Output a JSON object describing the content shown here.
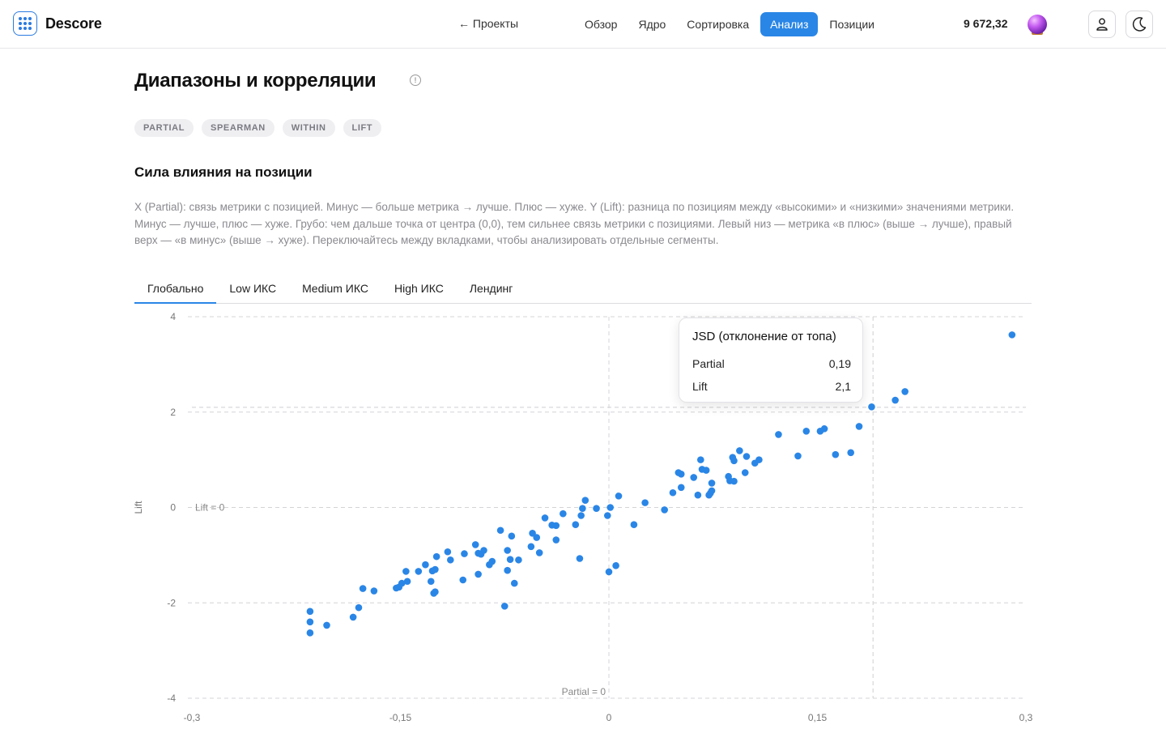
{
  "app": {
    "brand": "Descore",
    "back_label": "← Проекты",
    "nav": [
      "Обзор",
      "Ядро",
      "Сортировка",
      "Анализ",
      "Позиции"
    ],
    "nav_active": "Анализ",
    "balance": "9 672,32"
  },
  "page": {
    "title": "Диапазоны и корреляции",
    "chips": [
      "PARTIAL",
      "SPEARMAN",
      "WITHIN",
      "LIFT"
    ],
    "section_title": "Сила влияния на позиции",
    "description": "X (Partial): связь метрики с позицией. Минус — больше метрика → лучше. Плюс — хуже. Y (Lift): разница по позициям между «высокими» и «низкими» значениями метрики. Минус — лучше, плюс — хуже. Грубо: чем дальше точка от центра (0,0), тем сильнее связь метрики с позициями. Левый низ — метрика «в плюс» (выше → лучше), правый верх — «в минус» (выше → хуже). Переключайтесь между вкладками, чтобы анализировать отдельные сегменты.",
    "tabs": [
      "Глобально",
      "Low ИКС",
      "Medium ИКС",
      "High ИКС",
      "Лендинг"
    ],
    "tab_active": "Глобально"
  },
  "tooltip": {
    "title": "JSD (отклонение от топа)",
    "rows": [
      {
        "label": "Partial",
        "value": "0,19"
      },
      {
        "label": "Lift",
        "value": "2,1"
      }
    ]
  },
  "colors": {
    "accent": "#2a86e6",
    "point": "#2a86e6"
  },
  "chart_data": {
    "type": "scatter",
    "xlabel": "",
    "ylabel": "Lift",
    "xlim": [
      -0.3,
      0.3
    ],
    "ylim": [
      -4,
      4
    ],
    "x_ticks": [
      "-0,3",
      "-0,15",
      "0",
      "0,15",
      "0,3"
    ],
    "y_ticks": [
      "4",
      "2",
      "0",
      "-2",
      "-4"
    ],
    "annotations": [
      "Lift = 0",
      "Partial = 0"
    ],
    "grid": true,
    "crosshair": {
      "x": 0.19,
      "y": 2.1
    },
    "points": [
      [
        -0.215,
        -2.18
      ],
      [
        -0.215,
        -2.4
      ],
      [
        -0.215,
        -2.63
      ],
      [
        -0.203,
        -2.47
      ],
      [
        -0.184,
        -2.3
      ],
      [
        -0.18,
        -2.1
      ],
      [
        -0.177,
        -1.7
      ],
      [
        -0.169,
        -1.75
      ],
      [
        -0.153,
        -1.69
      ],
      [
        -0.151,
        -1.67
      ],
      [
        -0.149,
        -1.59
      ],
      [
        -0.146,
        -1.34
      ],
      [
        -0.145,
        -1.55
      ],
      [
        -0.137,
        -1.34
      ],
      [
        -0.132,
        -1.2
      ],
      [
        -0.128,
        -1.55
      ],
      [
        -0.127,
        -1.33
      ],
      [
        -0.126,
        -1.8
      ],
      [
        -0.125,
        -1.77
      ],
      [
        -0.125,
        -1.3
      ],
      [
        -0.124,
        -1.03
      ],
      [
        -0.116,
        -0.93
      ],
      [
        -0.114,
        -1.1
      ],
      [
        -0.105,
        -1.52
      ],
      [
        -0.104,
        -0.97
      ],
      [
        -0.096,
        -0.78
      ],
      [
        -0.094,
        -0.96
      ],
      [
        -0.094,
        -1.4
      ],
      [
        -0.092,
        -0.98
      ],
      [
        -0.09,
        -0.9
      ],
      [
        -0.086,
        -1.2
      ],
      [
        -0.084,
        -1.13
      ],
      [
        -0.078,
        -0.48
      ],
      [
        -0.073,
        -0.9
      ],
      [
        -0.075,
        -2.07
      ],
      [
        -0.073,
        -1.32
      ],
      [
        -0.071,
        -1.09
      ],
      [
        -0.07,
        -0.6
      ],
      [
        -0.068,
        -1.59
      ],
      [
        -0.065,
        -1.1
      ],
      [
        -0.056,
        -0.82
      ],
      [
        -0.055,
        -0.54
      ],
      [
        -0.052,
        -0.63
      ],
      [
        -0.05,
        -0.95
      ],
      [
        -0.046,
        -0.22
      ],
      [
        -0.038,
        -0.38
      ],
      [
        -0.038,
        -0.68
      ],
      [
        -0.041,
        -0.37
      ],
      [
        -0.033,
        -0.13
      ],
      [
        -0.024,
        -0.36
      ],
      [
        -0.021,
        -1.07
      ],
      [
        -0.02,
        -0.17
      ],
      [
        -0.019,
        -0.02
      ],
      [
        -0.017,
        0.15
      ],
      [
        -0.009,
        -0.02
      ],
      [
        -0.001,
        -0.17
      ],
      [
        0.0,
        -1.35
      ],
      [
        0.001,
        0.0
      ],
      [
        0.005,
        -1.22
      ],
      [
        0.007,
        0.24
      ],
      [
        0.018,
        -0.36
      ],
      [
        0.026,
        0.1
      ],
      [
        0.04,
        -0.05
      ],
      [
        0.046,
        0.31
      ],
      [
        0.05,
        0.73
      ],
      [
        0.052,
        0.7
      ],
      [
        0.052,
        0.42
      ],
      [
        0.061,
        0.63
      ],
      [
        0.064,
        0.26
      ],
      [
        0.066,
        1.0
      ],
      [
        0.067,
        0.8
      ],
      [
        0.07,
        0.78
      ],
      [
        0.072,
        0.26
      ],
      [
        0.073,
        0.3
      ],
      [
        0.074,
        0.51
      ],
      [
        0.074,
        0.35
      ],
      [
        0.086,
        0.65
      ],
      [
        0.087,
        0.56
      ],
      [
        0.089,
        1.05
      ],
      [
        0.09,
        0.98
      ],
      [
        0.09,
        0.55
      ],
      [
        0.094,
        1.19
      ],
      [
        0.098,
        0.73
      ],
      [
        0.099,
        1.07
      ],
      [
        0.105,
        0.93
      ],
      [
        0.108,
        1.0
      ],
      [
        0.122,
        1.53
      ],
      [
        0.136,
        1.08
      ],
      [
        0.142,
        1.6
      ],
      [
        0.152,
        1.6
      ],
      [
        0.155,
        1.65
      ],
      [
        0.163,
        1.11
      ],
      [
        0.174,
        1.15
      ],
      [
        0.18,
        1.7
      ],
      [
        0.189,
        2.11
      ],
      [
        0.206,
        2.25
      ],
      [
        0.213,
        2.43
      ],
      [
        0.29,
        3.62
      ]
    ]
  }
}
